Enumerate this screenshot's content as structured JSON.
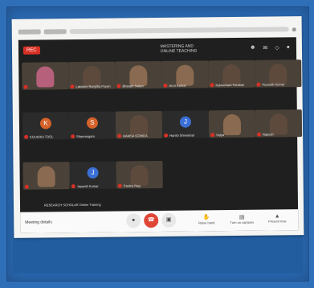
{
  "meeting": {
    "recording_badge": "REC",
    "presenter_line1": "MASTERING AND",
    "presenter_line2": "ONLINE TEACHING",
    "header_icons": [
      "people-icon",
      "chat-icon",
      "activities-icon",
      "account-icon"
    ]
  },
  "participants": [
    {
      "name": "",
      "kind": "video",
      "tone": "pink"
    },
    {
      "name": "Lakshmi Ranjitha Pravin",
      "kind": "video",
      "tone": "dark"
    },
    {
      "name": "Bharath Salian",
      "kind": "video",
      "tone": "brown"
    },
    {
      "name": "Arun Kumar",
      "kind": "video",
      "tone": "brown"
    },
    {
      "name": "Kulasekara Pandian",
      "kind": "video",
      "tone": "dark"
    },
    {
      "name": "Puneeth Kumar",
      "kind": "video",
      "tone": "dark"
    },
    {
      "name": "KOUSIKA TOOL",
      "kind": "avatar",
      "initial": "K"
    },
    {
      "name": "Shanmugam",
      "kind": "avatar",
      "initial": "S"
    },
    {
      "name": "HAMSA GOWDA",
      "kind": "video",
      "tone": "dark"
    },
    {
      "name": "Harish Shreekhar",
      "kind": "avatar",
      "initial": "J",
      "color": "blue"
    },
    {
      "name": "Vidya",
      "kind": "video",
      "tone": "brown"
    },
    {
      "name": "Rakesh",
      "kind": "video",
      "tone": "dark"
    },
    {
      "name": "",
      "kind": "video",
      "tone": "brown"
    },
    {
      "name": "Jayanth Kumar",
      "kind": "avatar",
      "initial": "J",
      "color": "blue"
    },
    {
      "name": "Pavitra Nag",
      "kind": "video",
      "tone": "dark"
    }
  ],
  "caption": "RESEARCH SCHOLAR Online Training",
  "bottom_bar": {
    "meeting_details": "Meeting details",
    "mic_icon": "mic-icon",
    "leave_icon": "phone-icon",
    "cam_icon": "camera-icon",
    "actions": [
      {
        "label": "Raise hand",
        "icon": "hand-icon"
      },
      {
        "label": "Turn on captions",
        "icon": "captions-icon"
      },
      {
        "label": "Present now",
        "icon": "present-icon"
      }
    ]
  }
}
